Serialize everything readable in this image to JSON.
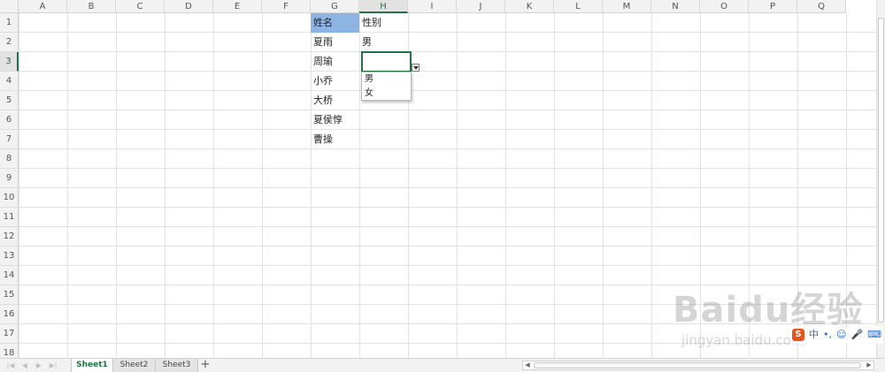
{
  "columns": [
    "A",
    "B",
    "C",
    "D",
    "E",
    "F",
    "G",
    "H",
    "I",
    "J",
    "K",
    "L",
    "M",
    "N",
    "O",
    "P",
    "Q"
  ],
  "rows": [
    "1",
    "2",
    "3",
    "4",
    "5",
    "6",
    "7",
    "8",
    "9",
    "10",
    "11",
    "12",
    "13",
    "14",
    "15",
    "16",
    "17",
    "18"
  ],
  "selected_column": "H",
  "selected_row": "3",
  "cells": {
    "G1": "姓名",
    "H1": "性别",
    "G2": "夏雨",
    "H2": "男",
    "G3": "周瑜",
    "G4": "小乔",
    "G5": "大桥",
    "G6": "夏侯惇",
    "G7": "曹操"
  },
  "dropdown": {
    "options": [
      "男",
      "女"
    ]
  },
  "sheet_tabs": [
    "Sheet1",
    "Sheet2",
    "Sheet3"
  ],
  "active_tab": "Sheet1",
  "add_tab_label": "+",
  "ime": {
    "logo": "S",
    "mode": "中",
    "punct": "•,",
    "emoji": "☺",
    "mic": "🎤",
    "keyboard": "⌨"
  },
  "watermark": {
    "text": "Baidu经验",
    "url": "jingyan.baidu.com"
  },
  "colors": {
    "accent": "#217346",
    "header_highlight": "#8db4e2"
  }
}
